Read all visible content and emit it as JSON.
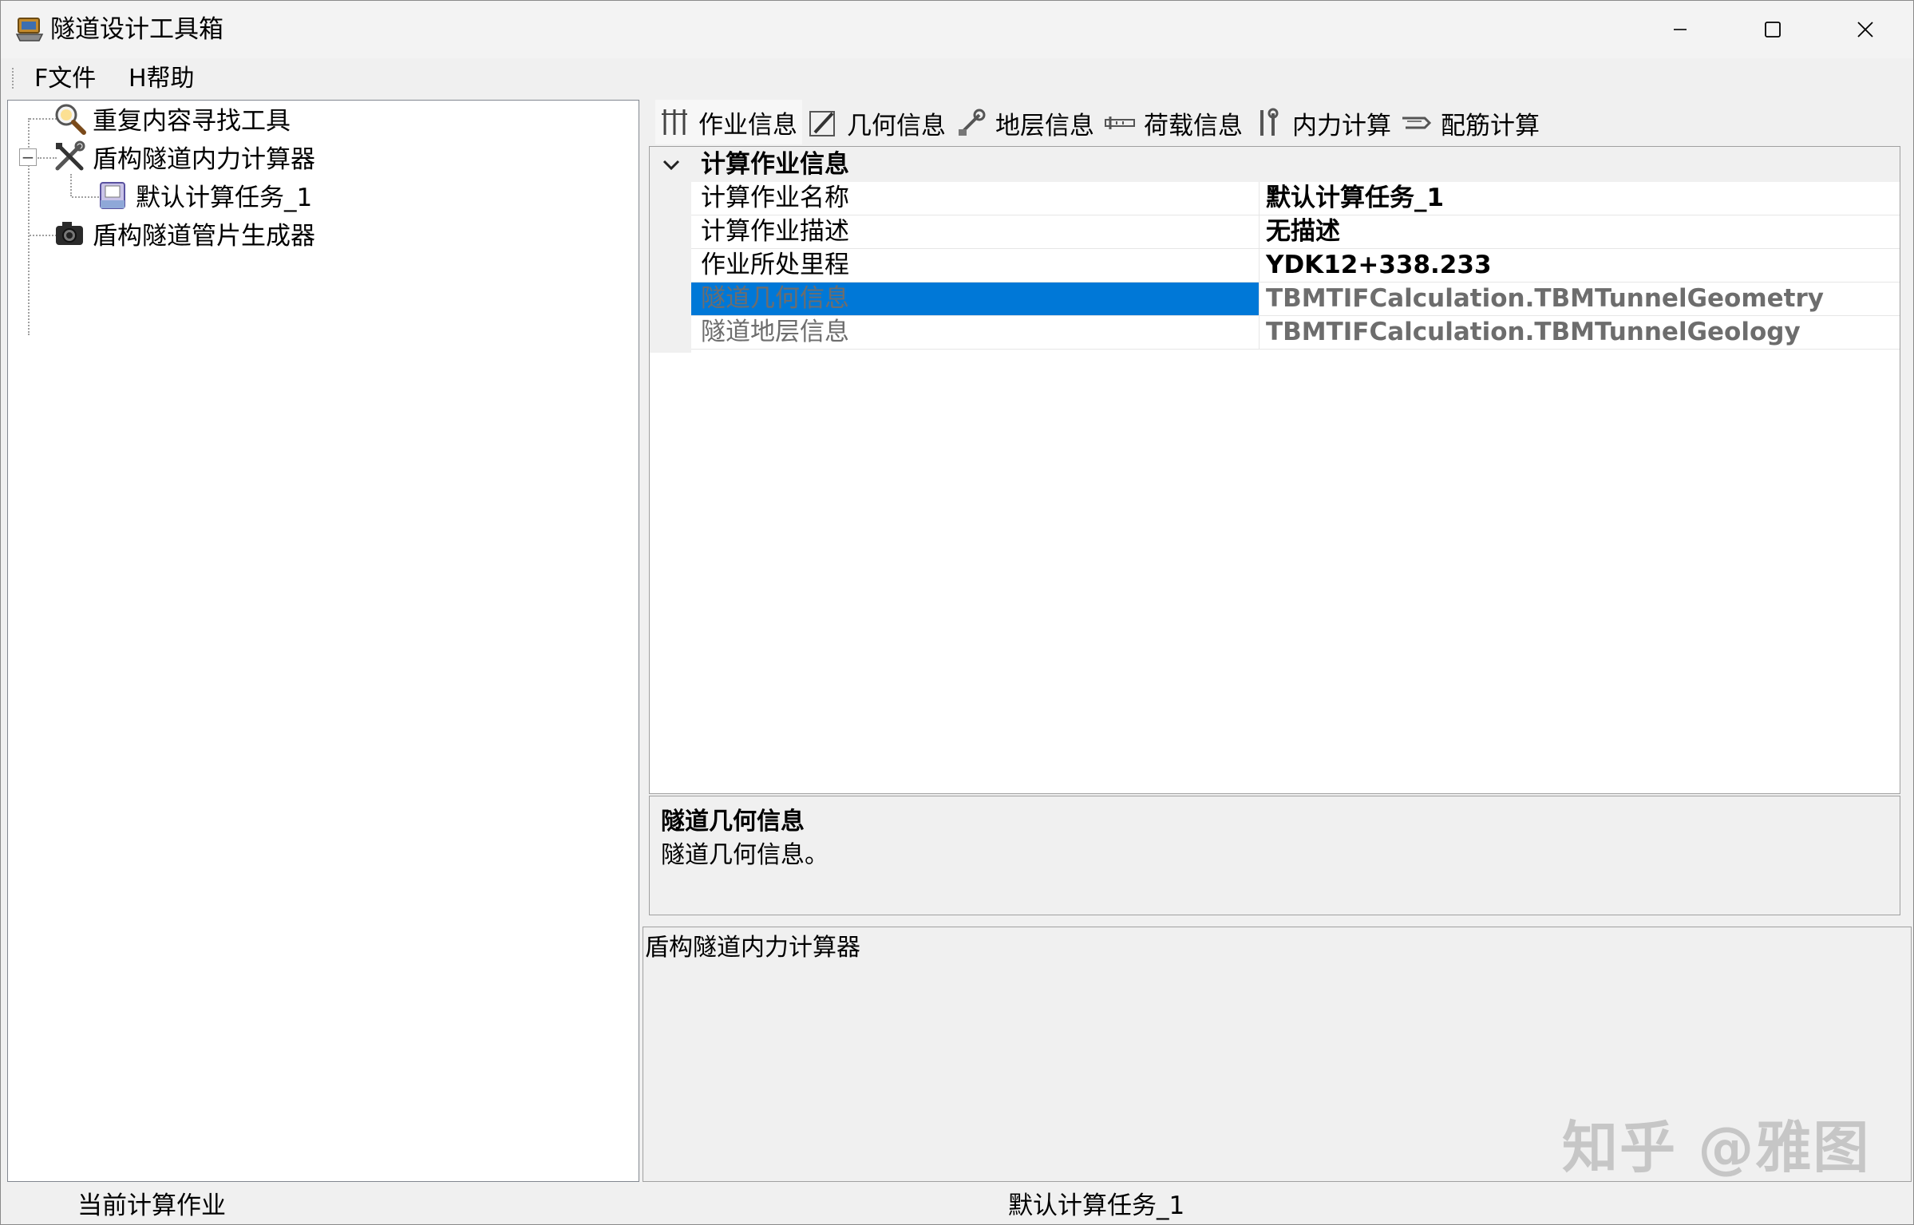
{
  "window": {
    "title": "隧道设计工具箱"
  },
  "menu": {
    "file": "F文件",
    "help": "H帮助"
  },
  "tree": {
    "items": [
      {
        "label": "重复内容寻找工具",
        "icon": "magnifier-icon"
      },
      {
        "label": "盾构隧道内力计算器",
        "icon": "tools-icon",
        "expanded": true
      },
      {
        "label": "默认计算任务_1",
        "icon": "document-icon"
      },
      {
        "label": "盾构隧道管片生成器",
        "icon": "camera-icon"
      }
    ],
    "expander_symbol": "−"
  },
  "tabs": [
    {
      "label": "作业信息",
      "icon": "caliper-icon",
      "active": true
    },
    {
      "label": "几何信息",
      "icon": "pencil-ruler-icon"
    },
    {
      "label": "地层信息",
      "icon": "strata-icon"
    },
    {
      "label": "荷载信息",
      "icon": "load-icon"
    },
    {
      "label": "内力计算",
      "icon": "wrench-icon"
    },
    {
      "label": "配筋计算",
      "icon": "rebar-icon"
    }
  ],
  "property_grid": {
    "category": "计算作业信息",
    "rows": [
      {
        "name": "计算作业名称",
        "value": "默认计算任务_1"
      },
      {
        "name": "计算作业描述",
        "value": "无描述"
      },
      {
        "name": "作业所处里程",
        "value": "YDK12+338.233"
      },
      {
        "name": "隧道几何信息",
        "value": "TBMTIFCalculation.TBMTunnelGeometry",
        "selected": true
      },
      {
        "name": "隧道地层信息",
        "value": "TBMTIFCalculation.TBMTunnelGeology"
      }
    ],
    "help_title": "隧道几何信息",
    "help_description": "隧道几何信息。"
  },
  "output": {
    "text": "盾构隧道内力计算器"
  },
  "status": {
    "label": "当前计算作业",
    "value": "默认计算任务_1"
  },
  "watermark": "知乎 @雅图",
  "colors": {
    "selection": "#0078d7",
    "readonly_text": "#6d6d6d"
  }
}
